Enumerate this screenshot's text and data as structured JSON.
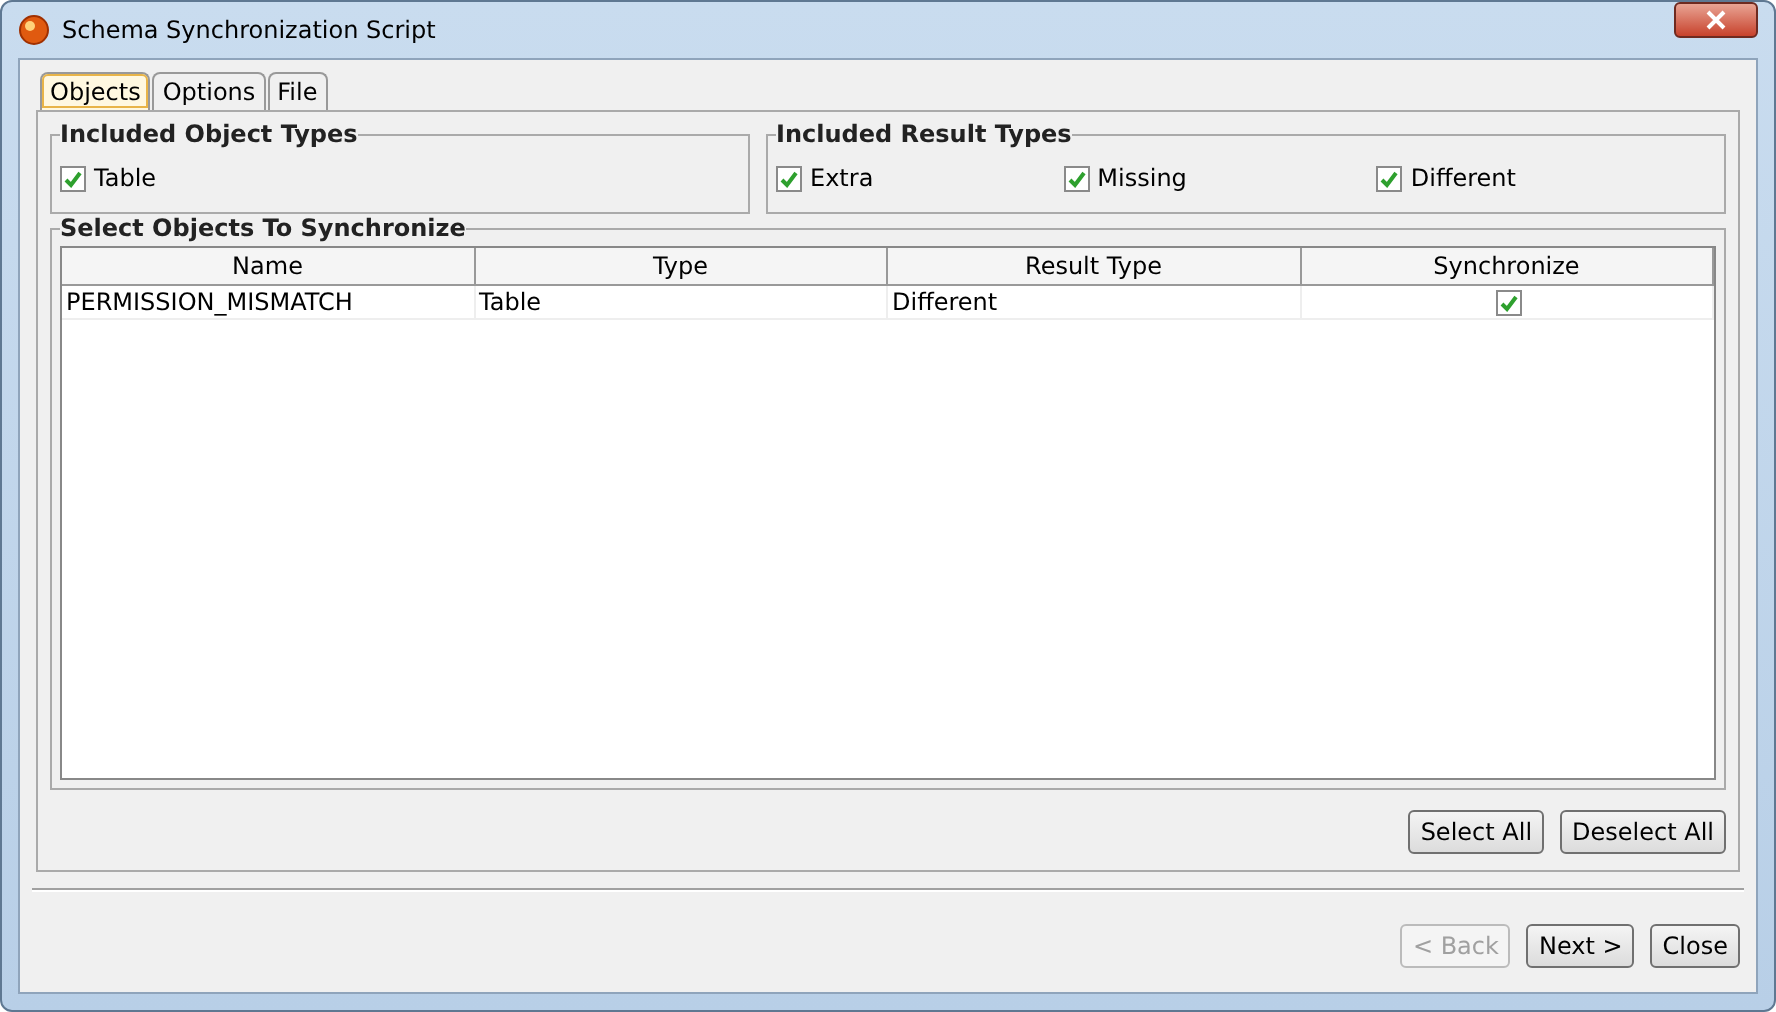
{
  "window": {
    "title": "Schema Synchronization Script"
  },
  "tabs": [
    {
      "label": "Objects",
      "selected": true
    },
    {
      "label": "Options",
      "selected": false
    },
    {
      "label": "File",
      "selected": false
    }
  ],
  "object_types": {
    "title": "Included Object Types",
    "options": [
      {
        "label": "Table",
        "checked": true
      }
    ]
  },
  "result_types": {
    "title": "Included Result Types",
    "options": [
      {
        "label": "Extra",
        "checked": true
      },
      {
        "label": "Missing",
        "checked": true
      },
      {
        "label": "Different",
        "checked": true
      }
    ]
  },
  "objects": {
    "title": "Select Objects To Synchronize",
    "columns": [
      "Name",
      "Type",
      "Result Type",
      "Synchronize"
    ],
    "rows": [
      {
        "name": "PERMISSION_MISMATCH",
        "type": "Table",
        "result_type": "Different",
        "synchronize": true
      }
    ]
  },
  "selection_buttons": [
    {
      "label": "Select All",
      "disabled": false
    },
    {
      "label": "Deselect All",
      "disabled": false
    }
  ],
  "nav_buttons": [
    {
      "label": "< Back",
      "disabled": true
    },
    {
      "label": "Next >",
      "disabled": false
    },
    {
      "label": "Close",
      "disabled": false
    }
  ]
}
